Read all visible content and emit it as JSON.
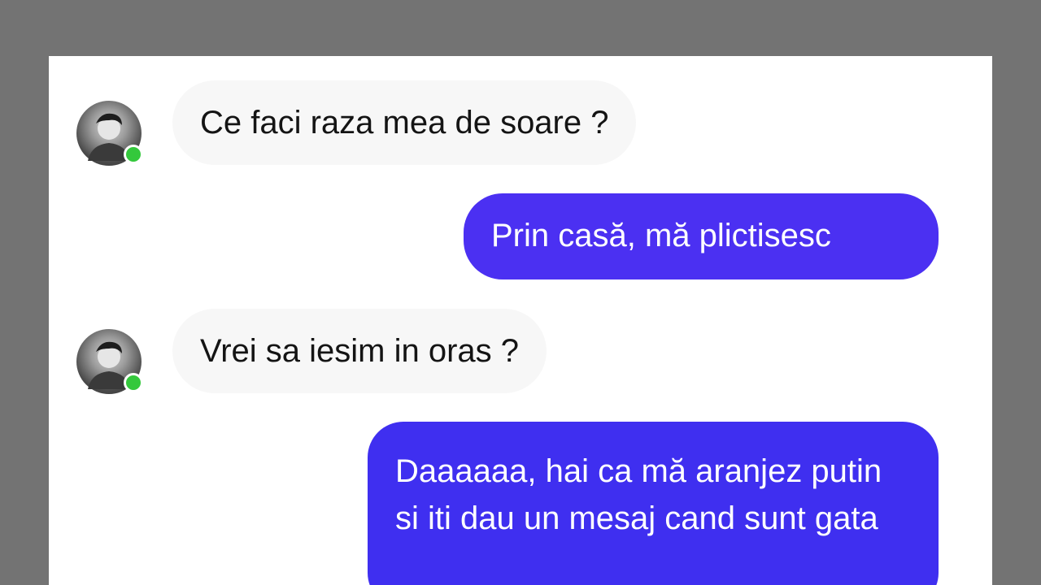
{
  "colors": {
    "background": "#737373",
    "panel": "#ffffff",
    "incoming_bubble": "#f7f7f7",
    "outgoing_bubble": "#4b30f2",
    "online_indicator": "#34c83c"
  },
  "messages": [
    {
      "direction": "incoming",
      "text": "Ce faci raza mea de soare ?",
      "avatar_icon": "contact-avatar",
      "online": true
    },
    {
      "direction": "outgoing",
      "text": "Prin casă, mă plictisesc"
    },
    {
      "direction": "incoming",
      "text": "Vrei sa iesim in oras ?",
      "avatar_icon": "contact-avatar",
      "online": true
    },
    {
      "direction": "outgoing",
      "text": "Daaaaaa, hai ca mă aranjez putin si iti dau un mesaj cand sunt gata"
    }
  ]
}
